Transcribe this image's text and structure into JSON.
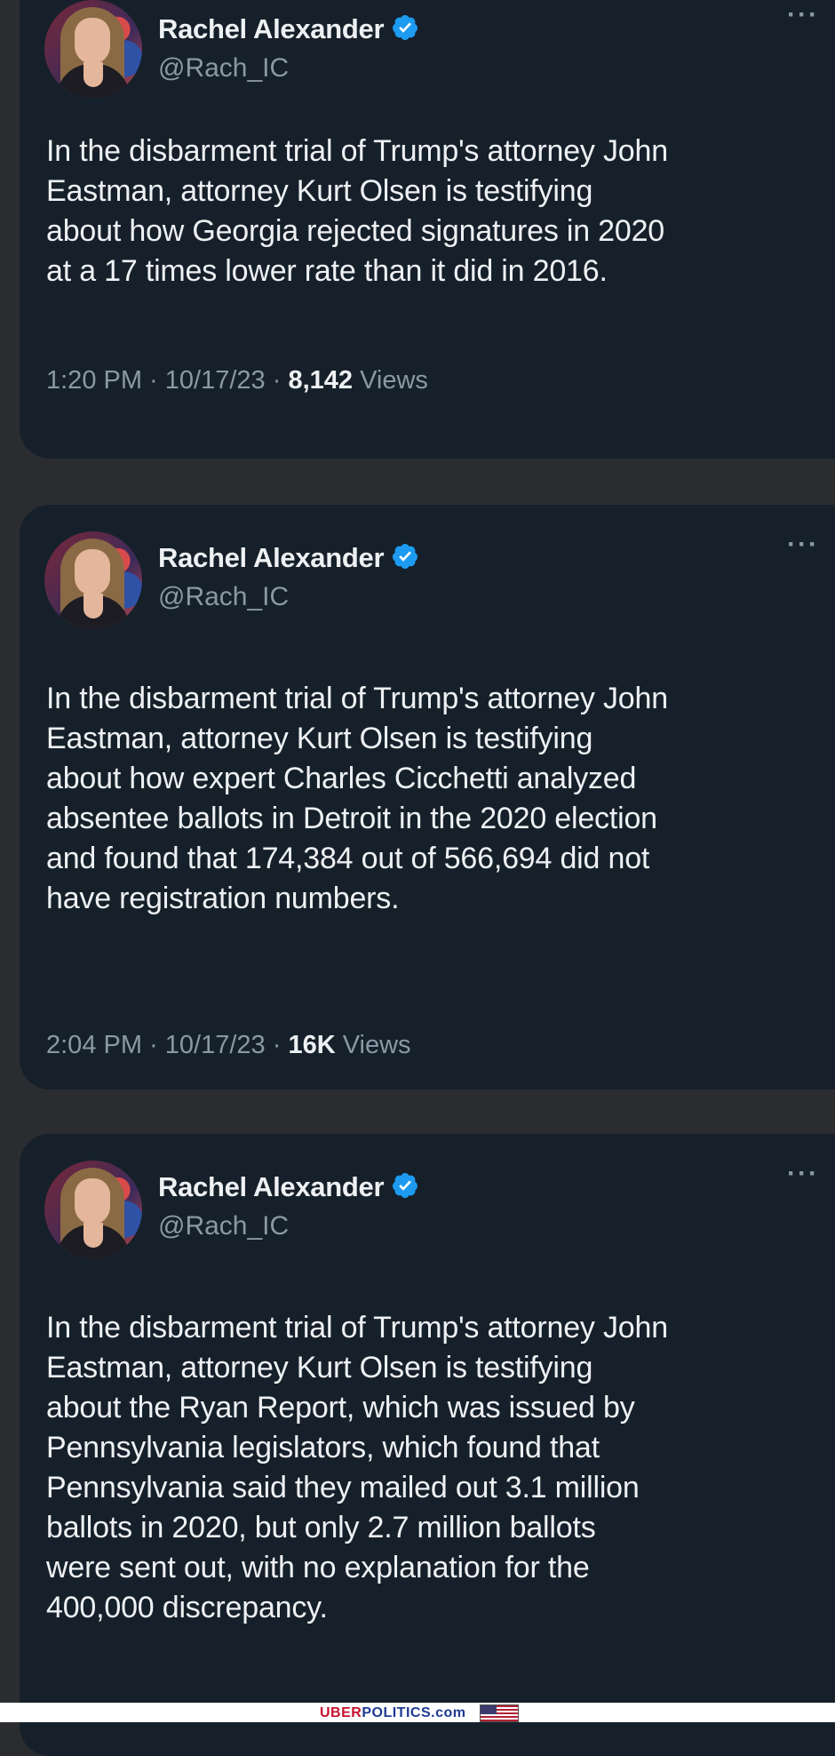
{
  "tweets": [
    {
      "author_name": "Rachel Alexander",
      "author_handle": "@Rach_IC",
      "more_label": "···",
      "text": "In the disbarment trial of Trump's attorney John Eastman, attorney Kurt Olsen is testifying about how Georgia rejected signatures in 2020 at a 17 times lower rate than it did in 2016.",
      "time_date": "1:20 PM · 10/17/23 · ",
      "views_count": "8,142",
      "views_label": " Views"
    },
    {
      "author_name": "Rachel Alexander",
      "author_handle": "@Rach_IC",
      "more_label": "···",
      "text": "In the disbarment trial of Trump's attorney John Eastman, attorney Kurt Olsen is testifying about how expert Charles Cicchetti analyzed absentee ballots in Detroit in the 2020 election and found that 174,384 out of 566,694 did not have registration numbers.",
      "time_date": "2:04 PM · 10/17/23 · ",
      "views_count": "16K",
      "views_label": " Views"
    },
    {
      "author_name": "Rachel Alexander",
      "author_handle": "@Rach_IC",
      "more_label": "···",
      "text": "In the disbarment trial of Trump's attorney John Eastman, attorney Kurt Olsen is testifying about the Ryan Report, which was issued by Pennsylvania legislators, which found that Pennsylvania said they mailed out 3.1 million ballots in 2020, but only 2.7 million ballots were sent out, with no explanation for the 400,000 discrepancy."
    }
  ],
  "watermark": {
    "part1": "UBER",
    "part2": "POLITICS.com"
  },
  "colors": {
    "background": "#2b2c30",
    "card": "#16202a",
    "text_primary": "#eef1f3",
    "text_secondary": "#8b98a5",
    "verified_badge": "#1d9bf0"
  }
}
